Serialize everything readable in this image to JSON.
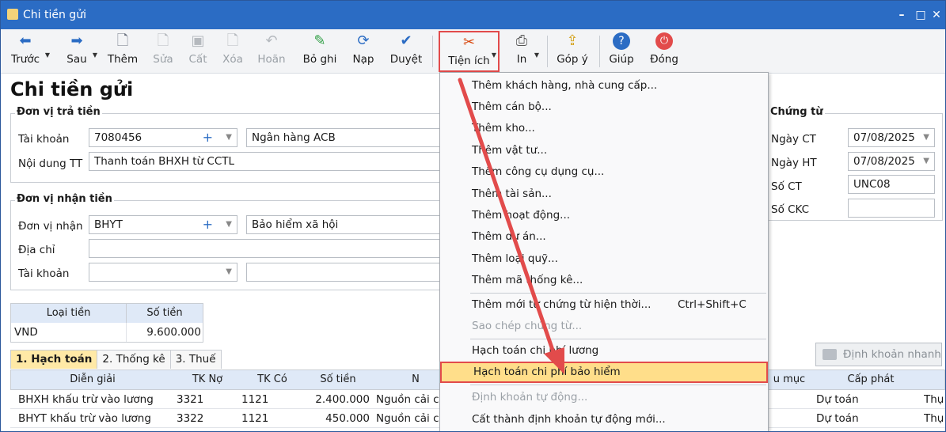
{
  "window": {
    "title": "Chi tiền gửi"
  },
  "toolbar": {
    "truoc": "Trước",
    "sau": "Sau",
    "them": "Thêm",
    "sua": "Sửa",
    "cat": "Cất",
    "xoa": "Xóa",
    "hoan": "Hoãn",
    "boghi": "Bỏ ghi",
    "nap": "Nạp",
    "duyet": "Duyệt",
    "tienich": "Tiện ích",
    "in": "In",
    "gopy": "Góp ý",
    "giup": "Giúp",
    "dong": "Đóng"
  },
  "page": {
    "title": "Chi tiền gửi"
  },
  "payer": {
    "title": "Đơn vị trả tiền",
    "account_label": "Tài khoản",
    "account_value": "7080456",
    "bank_name": "Ngân hàng ACB",
    "content_label": "Nội dung TT",
    "content_value": "Thanh toán BHXH từ CCTL"
  },
  "payee": {
    "title": "Đơn vị nhận tiền",
    "unit_label": "Đơn vị nhận",
    "unit_value": "BHYT",
    "unit_name": "Bảo hiểm xã hội",
    "address_label": "Địa chỉ",
    "account_label": "Tài khoản"
  },
  "voucher": {
    "title": "Chứng từ",
    "ngayct_label": "Ngày CT",
    "ngayct_value": "07/08/2025",
    "ngayht_label": "Ngày HT",
    "ngayht_value": "07/08/2025",
    "soct_label": "Số CT",
    "soct_value": "UNC08",
    "sockc_label": "Số CKC"
  },
  "currency": {
    "col_type": "Loại tiền",
    "col_amount": "Số tiền",
    "type": "VND",
    "amount": "9.600.000"
  },
  "tabs": {
    "hachtoan": "1. Hạch toán",
    "thongke": "2. Thống kê",
    "thue": "3. Thuế"
  },
  "grid": {
    "headers": {
      "dien_giai": "Diễn giải",
      "tk_no": "TK Nợ",
      "tk_co": "TK Có",
      "so_tien": "Số tiền",
      "n": "N",
      "muc": "u mục",
      "cap_phat": "Cấp phát"
    },
    "rows": [
      {
        "dien_giai": "BHXH khấu trừ vào lương",
        "tk_no": "3321",
        "tk_co": "1121",
        "so_tien": "2.400.000",
        "nguon": "Nguồn cải cá",
        "cap_phat": "Dự toán",
        "extra": "Thụ"
      },
      {
        "dien_giai": "BHYT khấu trừ vào lương",
        "tk_no": "3322",
        "tk_co": "1121",
        "so_tien": "450.000",
        "nguon": "Nguồn cải cá",
        "cap_phat": "Dự toán",
        "extra": "Thụ"
      }
    ]
  },
  "quick_entry": {
    "label": "Định khoản nhanh"
  },
  "menu": {
    "items": [
      "Thêm khách hàng, nhà cung cấp...",
      "Thêm cán bộ...",
      "Thêm kho...",
      "Thêm vật tư...",
      "Thêm công cụ dụng cụ...",
      "Thêm tài sản...",
      "Thêm hoạt động...",
      "Thêm dự án...",
      "Thêm loại quỹ...",
      "Thêm mã thống kê...",
      "Thêm mới từ chứng từ hiện thời...",
      "Sao chép chứng từ...",
      "Hạch toán chi phí lương",
      "Hạch toán chi phí bảo hiểm",
      "Định khoản tự động...",
      "Cất thành định khoản tự động mới..."
    ],
    "shortcut_new_from_current": "Ctrl+Shift+C"
  },
  "colors": {
    "accent": "#2b6cc4",
    "highlight": "#ffde8a",
    "annotation": "#e24b4b"
  }
}
